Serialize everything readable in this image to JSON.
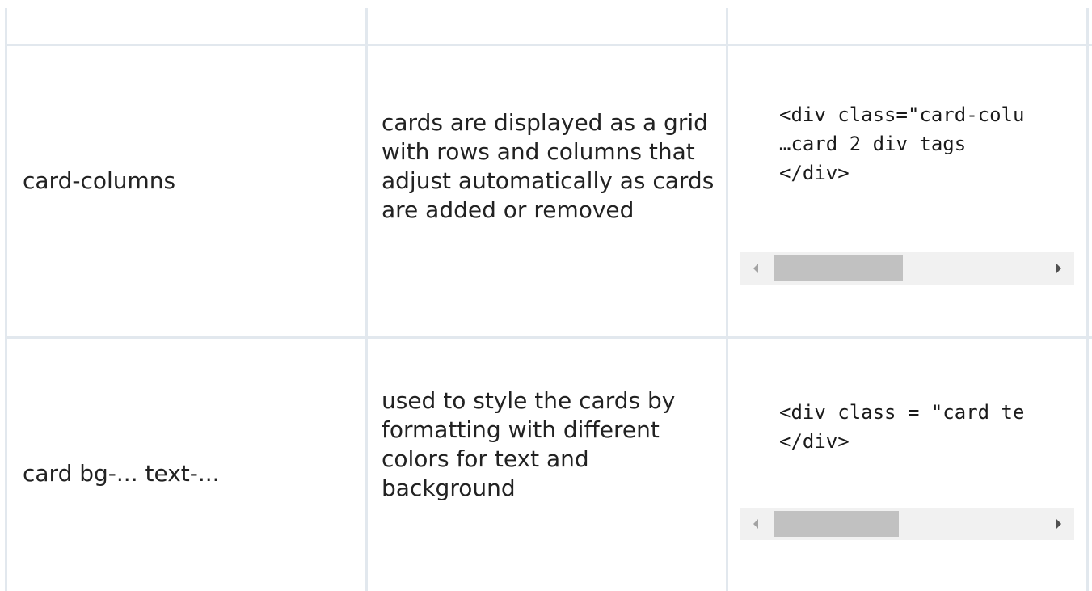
{
  "rows": [
    {
      "class_name": "card-columns",
      "description": "cards are displayed as a grid with rows and columns that adjust automatically as cards are added or removed",
      "code_lines": [
        "<div class=\"card-colu",
        "…card 2 div tags",
        "</div>"
      ]
    },
    {
      "class_name": "card bg-... text-...",
      "description": "used to style the cards by formatting with different colors for text and background",
      "code_lines": [
        "<div class = \"card te",
        "</div>"
      ]
    }
  ],
  "colors": {
    "border": "#e2e8ee",
    "scrollbar_track": "#f1f1f1",
    "scrollbar_thumb": "#c1c1c1",
    "text": "#222222"
  },
  "icons": {
    "scroll_left": "scroll-left-arrow-icon",
    "scroll_right": "scroll-right-arrow-icon"
  }
}
